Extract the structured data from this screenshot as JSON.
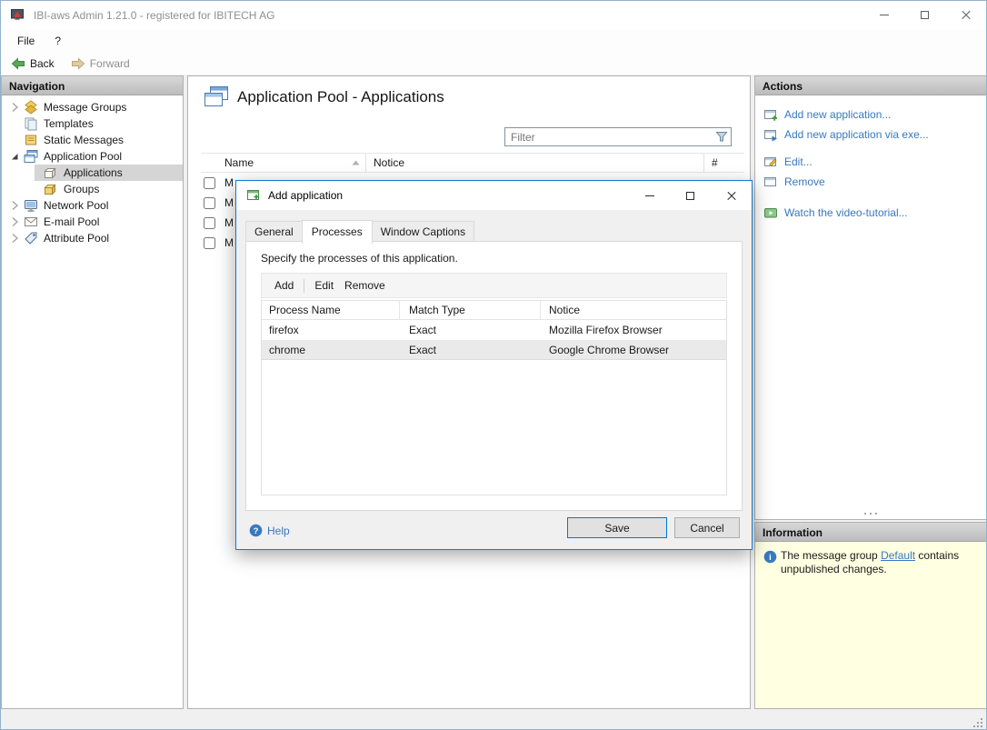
{
  "window": {
    "title": "IBI-aws Admin 1.21.0 - registered for IBITECH AG"
  },
  "menu": {
    "file": "File",
    "help": "?"
  },
  "toolbar": {
    "back": "Back",
    "forward": "Forward"
  },
  "navigation": {
    "header": "Navigation",
    "items": [
      {
        "label": "Message Groups",
        "icon": "message-groups-icon",
        "state": "collapsed"
      },
      {
        "label": "Templates",
        "icon": "templates-icon"
      },
      {
        "label": "Static Messages",
        "icon": "static-messages-icon"
      },
      {
        "label": "Application Pool",
        "icon": "application-pool-icon",
        "state": "expanded"
      },
      {
        "label": "Applications",
        "icon": "applications-icon",
        "selected": true
      },
      {
        "label": "Groups",
        "icon": "groups-icon"
      },
      {
        "label": "Network Pool",
        "icon": "network-pool-icon",
        "state": "collapsed"
      },
      {
        "label": "E-mail Pool",
        "icon": "email-pool-icon",
        "state": "collapsed"
      },
      {
        "label": "Attribute Pool",
        "icon": "attribute-pool-icon",
        "state": "collapsed"
      }
    ]
  },
  "main": {
    "title": "Application Pool - Applications",
    "filter": {
      "placeholder": "Filter"
    },
    "table": {
      "columns": {
        "name": "Name",
        "notice": "Notice",
        "count": "#"
      },
      "rows": [
        {
          "name": "M"
        },
        {
          "name": "M"
        },
        {
          "name": "M"
        },
        {
          "name": "M"
        }
      ]
    }
  },
  "dialog": {
    "title": "Add application",
    "tabs": {
      "general": "General",
      "processes": "Processes",
      "window_captions": "Window Captions"
    },
    "active_tab": "Processes",
    "description": "Specify the processes of this application.",
    "toolbar": {
      "add": "Add",
      "edit": "Edit",
      "remove": "Remove"
    },
    "table": {
      "columns": {
        "process_name": "Process Name",
        "match_type": "Match Type",
        "notice": "Notice"
      },
      "rows": [
        {
          "process_name": "firefox",
          "match_type": "Exact",
          "notice": "Mozilla Firefox Browser",
          "selected": false
        },
        {
          "process_name": "chrome",
          "match_type": "Exact",
          "notice": "Google Chrome Browser",
          "selected": true
        }
      ]
    },
    "help": "Help",
    "buttons": {
      "save": "Save",
      "cancel": "Cancel"
    }
  },
  "actions": {
    "header": "Actions",
    "items": [
      {
        "label": "Add new application...",
        "icon": "add-application-icon"
      },
      {
        "label": "Add new application via exe...",
        "icon": "add-application-exe-icon"
      },
      {
        "label": "Edit...",
        "icon": "edit-application-icon"
      },
      {
        "label": "Remove",
        "icon": "remove-application-icon"
      },
      {
        "label": "Watch the video-tutorial...",
        "icon": "video-tutorial-icon"
      }
    ]
  },
  "information": {
    "header": "Information",
    "message_prefix": "The message group ",
    "link": "Default",
    "message_suffix": " contains unpublished changes."
  },
  "icons": {
    "help_glyph": "?",
    "info_glyph": "i"
  }
}
